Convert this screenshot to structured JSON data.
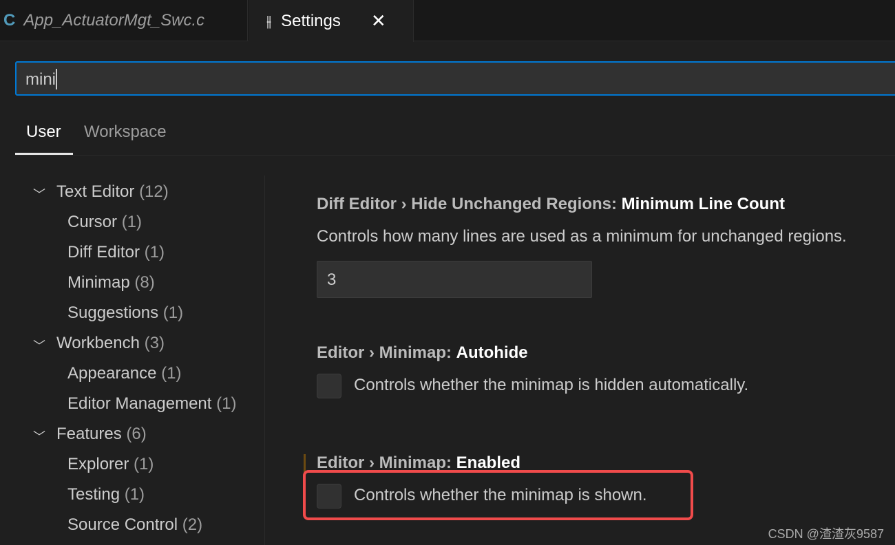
{
  "tabs": [
    {
      "label": "App_ActuatorMgt_Swc.c",
      "icon": "c-file-icon",
      "active": false
    },
    {
      "label": "Settings",
      "icon": "settings-sliders-icon",
      "active": true,
      "close": "✕"
    }
  ],
  "search": {
    "value": "mini"
  },
  "scope_tabs": [
    {
      "label": "User",
      "active": true
    },
    {
      "label": "Workspace",
      "active": false
    }
  ],
  "tree": [
    {
      "label": "Text Editor",
      "count": "(12)",
      "level": 0
    },
    {
      "label": "Cursor",
      "count": "(1)",
      "level": 1
    },
    {
      "label": "Diff Editor",
      "count": "(1)",
      "level": 1
    },
    {
      "label": "Minimap",
      "count": "(8)",
      "level": 1
    },
    {
      "label": "Suggestions",
      "count": "(1)",
      "level": 1
    },
    {
      "label": "Workbench",
      "count": "(3)",
      "level": 0
    },
    {
      "label": "Appearance",
      "count": "(1)",
      "level": 1
    },
    {
      "label": "Editor Management",
      "count": "(1)",
      "level": 1
    },
    {
      "label": "Features",
      "count": "(6)",
      "level": 0
    },
    {
      "label": "Explorer",
      "count": "(1)",
      "level": 1
    },
    {
      "label": "Testing",
      "count": "(1)",
      "level": 1
    },
    {
      "label": "Source Control",
      "count": "(2)",
      "level": 1
    }
  ],
  "settings": [
    {
      "category": "Diff Editor › Hide Unchanged Regions: ",
      "name": "Minimum Line Count",
      "description": "Controls how many lines are used as a minimum for unchanged regions.",
      "value": "3"
    },
    {
      "category": "Editor › Minimap: ",
      "name": "Autohide",
      "description": "Controls whether the minimap is hidden automatically.",
      "checked": false
    },
    {
      "category": "Editor › Minimap: ",
      "name": "Enabled",
      "description": "Controls whether the minimap is shown.",
      "checked": false,
      "modified": true
    }
  ],
  "highlight_color": "#f04b4b",
  "watermark": "CSDN @渣渣灰9587"
}
